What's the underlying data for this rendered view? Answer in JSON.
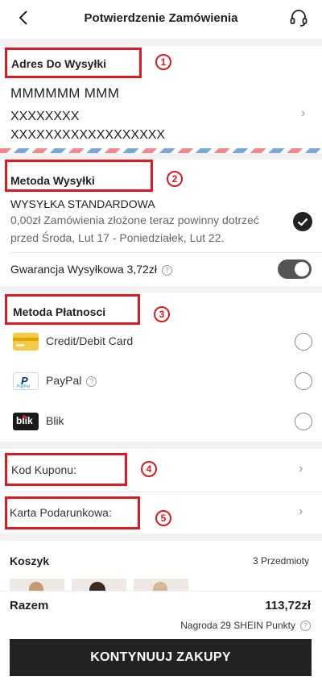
{
  "header": {
    "title": "Potwierdzenie Zamówienia"
  },
  "address": {
    "section_title": "Adres Do Wysyłki",
    "badge": "1",
    "name": "MMMMMM MMM",
    "line1": "XXXXXXXX",
    "line2": "XXXXXXXXXXXXXXXXXX"
  },
  "shipping": {
    "section_title": "Metoda Wysyłki",
    "badge": "2",
    "method_name": "WYSYŁKA STANDARDOWA",
    "method_desc": "0,00zł Zamówienia złożone teraz powinny dotrzeć przed Środa, Lut 17 - Poniedziałek, Lut 22.",
    "guarantee_label": "Gwarancja Wysyłkowa 3,72zł",
    "guarantee_enabled": true
  },
  "payment": {
    "section_title": "Metoda Płatnosci",
    "badge": "3",
    "options": [
      {
        "label": "Credit/Debit Card"
      },
      {
        "label": "PayPal"
      },
      {
        "label": "Blik"
      }
    ]
  },
  "coupon": {
    "label": "Kod Kuponu:",
    "badge": "4"
  },
  "gift_card": {
    "label": "Karta Podarunkowa:",
    "badge": "5"
  },
  "basket": {
    "title": "Koszyk",
    "count": "3 Przedmioty"
  },
  "footer": {
    "total_label": "Razem",
    "total_value": "113,72zł",
    "reward": "Nagroda 29 SHEIN Punkty",
    "cta": "KONTYNUUJ ZAKUPY"
  },
  "icons": {
    "paypal_logo": "PayPal",
    "blik_logo": "blik"
  },
  "colors": {
    "annotation_red": "#e0181f",
    "cta_bg": "#222222",
    "toggle_on": "#555555"
  }
}
